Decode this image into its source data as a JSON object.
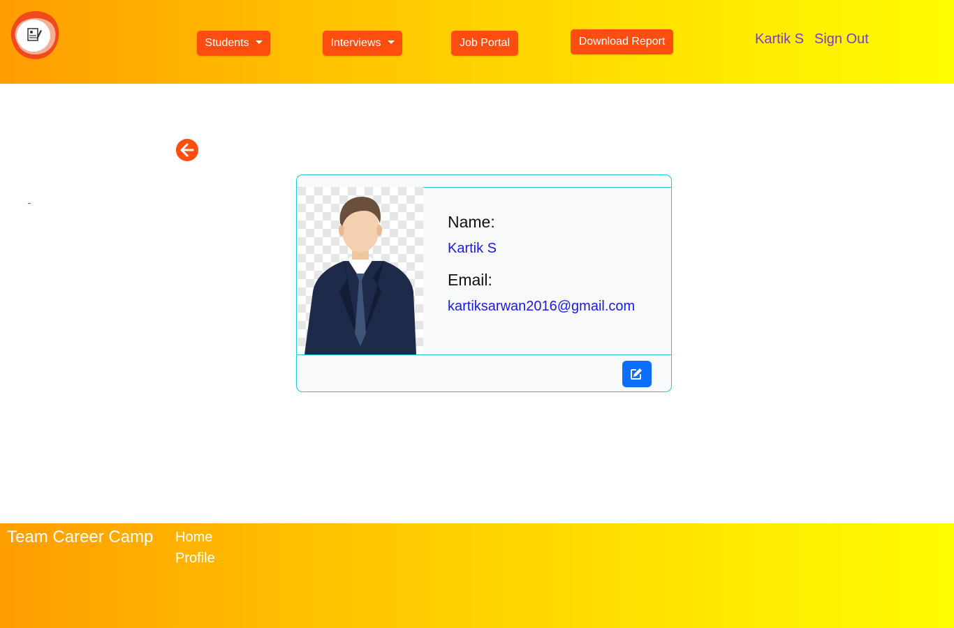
{
  "colors": {
    "accent": "#fd4d0f",
    "user_link": "#7a3bd0",
    "card_border": "#1fc7da",
    "value_text": "#1a1ae6",
    "edit_button": "#0d6efd"
  },
  "header": {
    "logo_icon": "resume-document-icon",
    "nav": {
      "students": "Students",
      "interviews": "Interviews",
      "job_portal": "Job Portal",
      "download_report": "Download Report"
    },
    "user_name": "Kartik S",
    "sign_out": "Sign Out"
  },
  "back_icon": "arrow-left-circle-icon",
  "profile": {
    "avatar_icon": "businessman-avatar",
    "name_label": "Name:",
    "name_value": "Kartik S",
    "email_label": "Email:",
    "email_value": "kartiksarwan2016@gmail.com",
    "edit_icon": "pencil-square-icon"
  },
  "footer": {
    "brand": "Team Career Camp",
    "links": [
      "Home",
      "Profile"
    ]
  }
}
